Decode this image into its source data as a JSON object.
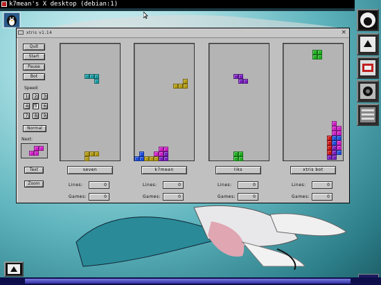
{
  "terminal": {
    "title": "k7mean's X desktop (debian:1)"
  },
  "window": {
    "title": "xtris v1.14",
    "close": "×"
  },
  "controls": {
    "quit": "Quit",
    "start": "Start",
    "pause": "Pause",
    "bot": "Bot",
    "speed_label": "Speed:",
    "speeds": [
      "1",
      "2",
      "3",
      "4",
      "5",
      "6",
      "7",
      "8",
      "9"
    ],
    "speed_selected": "5",
    "normal": "Normal",
    "next_label": "Next:",
    "text": "Text",
    "zoom": "Zoom"
  },
  "players": [
    {
      "name": "seven",
      "lines_label": "Lines:",
      "lines": "0",
      "games_label": "Games:",
      "games": "0"
    },
    {
      "name": "k7mean",
      "lines_label": "Lines:",
      "lines": "0",
      "games_label": "Games:",
      "games": "0"
    },
    {
      "name": "liks",
      "lines_label": "Lines:",
      "lines": "0",
      "games_label": "Games:",
      "games": "0"
    },
    {
      "name": "xtris bot",
      "lines_label": "Lines:",
      "lines": "0",
      "games_label": "Games:",
      "games": "0"
    }
  ],
  "colors": {
    "teal": "#1a9aa0",
    "olive": "#b39a10",
    "magenta": "#d020c8",
    "green": "#20b020",
    "purple": "#7a20c0",
    "blue": "#2050e0",
    "red": "#d01818",
    "window_bg": "#c0c0c0",
    "desktop": "#5fb4bd"
  },
  "icons": [
    "menu-icon",
    "close-icon",
    "terminal-icon",
    "dock-app-icon"
  ]
}
